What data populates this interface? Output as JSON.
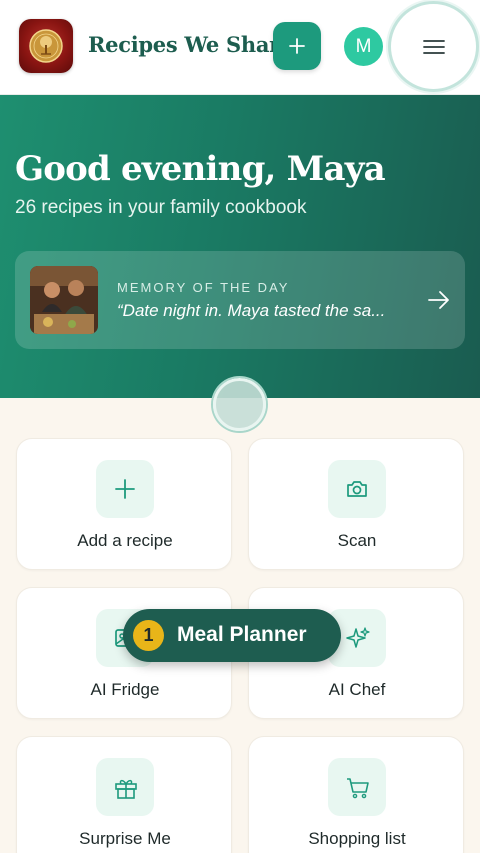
{
  "header": {
    "title": "Recipes We Share",
    "add_icon": "plus-icon",
    "avatar_initial": "M",
    "menu_icon": "hamburger-menu-icon"
  },
  "hero": {
    "greeting": "Good evening, Maya",
    "subtitle": "26 recipes in your family cookbook",
    "memory": {
      "label": "MEMORY OF THE DAY",
      "quote": "“Date night in. Maya tasted the sa...",
      "arrow_icon": "arrow-right-icon"
    }
  },
  "actions": [
    {
      "label": "Add a recipe",
      "icon": "plus-icon"
    },
    {
      "label": "Scan",
      "icon": "camera-icon"
    },
    {
      "label": "AI Fridge",
      "icon": "image-icon"
    },
    {
      "label": "AI Chef",
      "icon": "sparkles-icon"
    },
    {
      "label": "Surprise Me",
      "icon": "gift-icon"
    },
    {
      "label": "Shopping list",
      "icon": "cart-icon"
    }
  ],
  "meal_planner": {
    "badge": "1",
    "label": "Meal Planner"
  },
  "colors": {
    "brand_green": "#1d9a7d",
    "hero_dark": "#1a5c50",
    "badge_yellow": "#e8b519",
    "background": "#fbf6ee"
  }
}
